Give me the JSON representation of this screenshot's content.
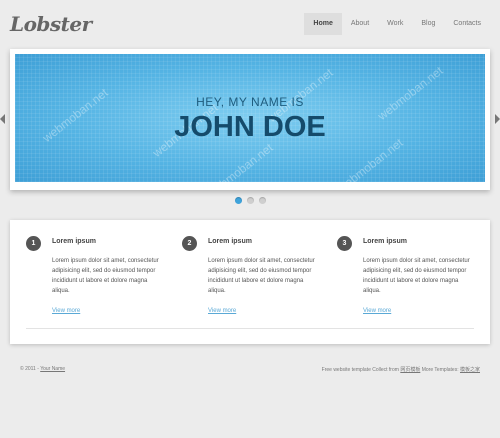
{
  "header": {
    "logo": "Lobster",
    "nav": [
      {
        "label": "Home",
        "active": true
      },
      {
        "label": "About",
        "active": false
      },
      {
        "label": "Work",
        "active": false
      },
      {
        "label": "Blog",
        "active": false
      },
      {
        "label": "Contacts",
        "active": false
      }
    ]
  },
  "slider": {
    "subtitle": "HEY, MY NAME IS",
    "title": "JOHN DOE",
    "watermark": "webmoban.net",
    "active_dot": 1,
    "dot_count": 3
  },
  "features": [
    {
      "number": "1",
      "title": "Lorem ipsum",
      "text": "Lorem ipsum dolor sit amet, consectetur adipisicing elit, sed do eiusmod tempor incididunt ut labore et dolore magna aliqua.",
      "link": "View more"
    },
    {
      "number": "2",
      "title": "Lorem ipsum",
      "text": "Lorem ipsum dolor sit amet, consectetur adipisicing elit, sed do eiusmod tempor incididunt ut labore et dolore magna aliqua.",
      "link": "View more"
    },
    {
      "number": "3",
      "title": "Lorem ipsum",
      "text": "Lorem ipsum dolor sit amet, consectetur adipisicing elit, sed do eiusmod tempor incididunt ut labore et dolore magna aliqua.",
      "link": "View more"
    }
  ],
  "footer": {
    "copyright": "© 2011 -",
    "name_link": "Your Name",
    "credit_prefix": "Free website template Collect from",
    "credit_link1": "网页模板",
    "credit_mid": "More Templates",
    "credit_link2": "模板之家"
  },
  "colors": {
    "accent": "#3ea3db",
    "slide_text": "#154b6b",
    "link": "#5aa9d6"
  }
}
